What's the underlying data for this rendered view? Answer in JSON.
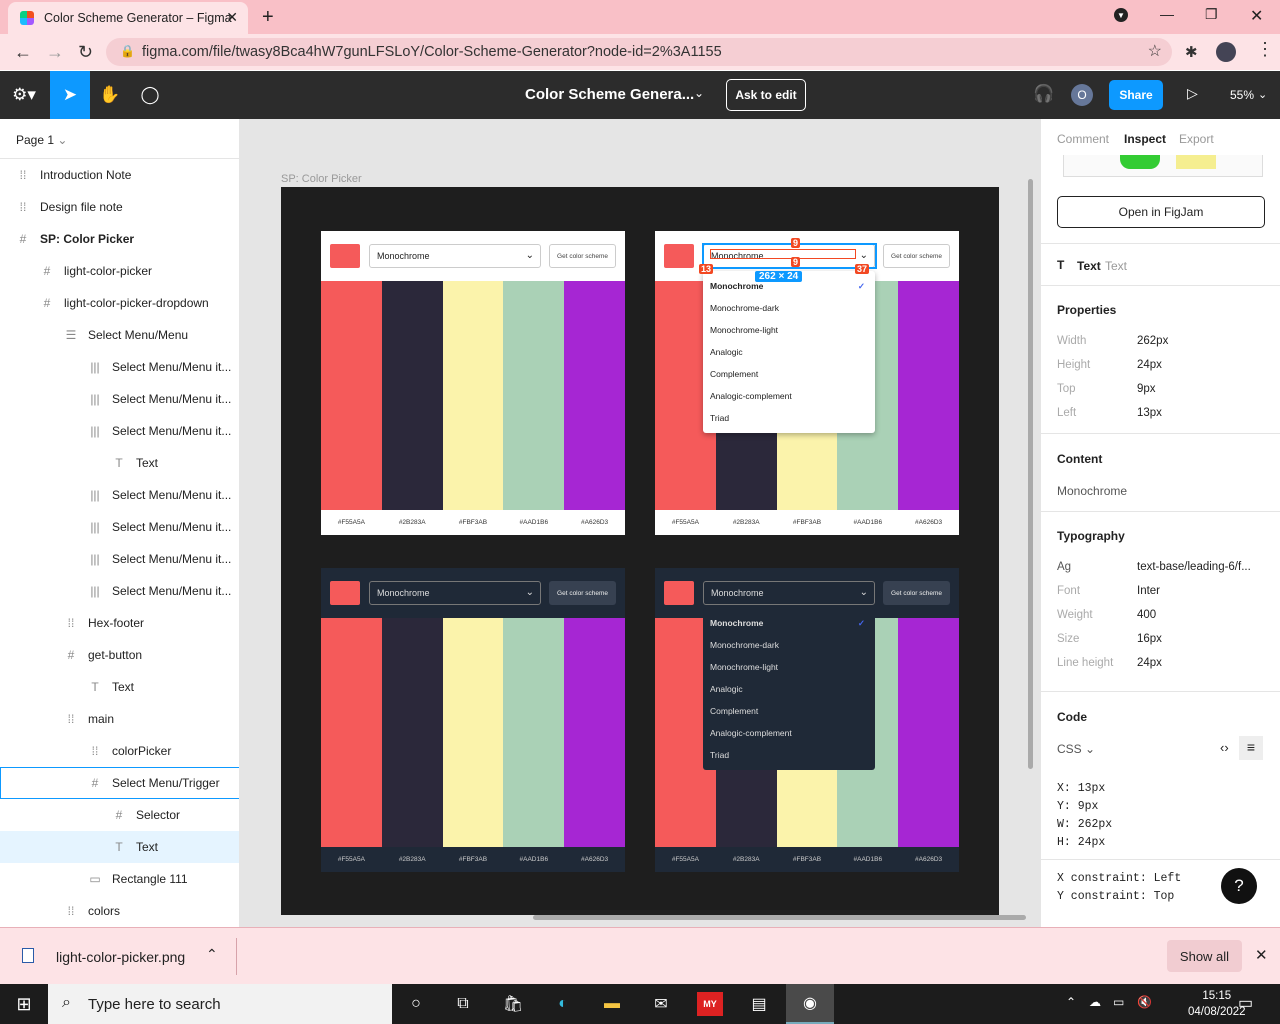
{
  "browser": {
    "tab_title": "Color Scheme Generator – Figma",
    "url": "figma.com/file/twasy8Bca4hW7gunLFSLoY/Color-Scheme-Generator?node-id=2%3A1155"
  },
  "figma": {
    "file_title": "Color Scheme Genera...",
    "ask_to_edit": "Ask to edit",
    "share": "Share",
    "avatar_letter": "O",
    "zoom": "55%"
  },
  "layers_panel": {
    "page": "Page 1",
    "items": [
      {
        "label": "Introduction Note",
        "icon": "dashed-frame-icon",
        "glyph": "⁞⁞"
      },
      {
        "label": "Design file note",
        "icon": "dashed-frame-icon",
        "glyph": "⁞⁞"
      },
      {
        "label": "SP: Color Picker",
        "icon": "frame-icon",
        "glyph": "#"
      },
      {
        "label": "light-color-picker",
        "icon": "frame-icon",
        "glyph": "#"
      },
      {
        "label": "light-color-picker-dropdown",
        "icon": "frame-icon",
        "glyph": "#"
      },
      {
        "label": "Select Menu/Menu",
        "icon": "vertical-autolayout-icon",
        "glyph": "☰"
      },
      {
        "label": "Select Menu/Menu it...",
        "icon": "horizontal-autolayout-icon",
        "glyph": "|||"
      },
      {
        "label": "Select Menu/Menu it...",
        "icon": "horizontal-autolayout-icon",
        "glyph": "|||"
      },
      {
        "label": "Select Menu/Menu it...",
        "icon": "horizontal-autolayout-icon",
        "glyph": "|||"
      },
      {
        "label": "Text",
        "icon": "text-icon",
        "glyph": "T"
      },
      {
        "label": "Select Menu/Menu it...",
        "icon": "horizontal-autolayout-icon",
        "glyph": "|||"
      },
      {
        "label": "Select Menu/Menu it...",
        "icon": "horizontal-autolayout-icon",
        "glyph": "|||"
      },
      {
        "label": "Select Menu/Menu it...",
        "icon": "horizontal-autolayout-icon",
        "glyph": "|||"
      },
      {
        "label": "Select Menu/Menu it...",
        "icon": "horizontal-autolayout-icon",
        "glyph": "|||"
      },
      {
        "label": "Hex-footer",
        "icon": "dashed-frame-icon",
        "glyph": "⁞⁞"
      },
      {
        "label": "get-button",
        "icon": "frame-icon",
        "glyph": "#"
      },
      {
        "label": "Text",
        "icon": "text-icon",
        "glyph": "T"
      },
      {
        "label": "main",
        "icon": "dashed-frame-icon",
        "glyph": "⁞⁞"
      },
      {
        "label": "colorPicker",
        "icon": "dashed-frame-icon",
        "glyph": "⁞⁞"
      },
      {
        "label": "Select Menu/Trigger",
        "icon": "frame-icon",
        "glyph": "#"
      },
      {
        "label": "Selector",
        "icon": "frame-icon",
        "glyph": "#"
      },
      {
        "label": "Text",
        "icon": "text-icon",
        "glyph": "T"
      },
      {
        "label": "Rectangle 111",
        "icon": "rectangle-icon",
        "glyph": "▭"
      },
      {
        "label": "colors",
        "icon": "dashed-frame-icon",
        "glyph": "⁞⁞"
      }
    ]
  },
  "canvas": {
    "frame_label": "SP: Color Picker",
    "select_value": "Monochrome",
    "get_button": "Get color scheme",
    "stripe_colors": [
      "#F55A5A",
      "#2B283A",
      "#FBF3AB",
      "#AAD1B6",
      "#A626D3"
    ],
    "hex_labels": [
      "#F55A5A",
      "#2B283A",
      "#FBF3AB",
      "#AAD1B6",
      "#A626D3"
    ],
    "menu_options": [
      "Monochrome",
      "Monochrome-dark",
      "Monochrome-light",
      "Analogic",
      "Complement",
      "Analogic-complement",
      "Triad"
    ],
    "measure": {
      "top": "9",
      "bottom": "9",
      "left": "13",
      "right": "37",
      "size": "262 × 24"
    }
  },
  "inspect_panel": {
    "tabs": [
      "Comment",
      "Inspect",
      "Export"
    ],
    "open_figjam": "Open in FigJam",
    "layer_type": "Text",
    "layer_name": "Text",
    "properties_title": "Properties",
    "properties": [
      {
        "label": "Width",
        "value": "262px"
      },
      {
        "label": "Height",
        "value": "24px"
      },
      {
        "label": "Top",
        "value": "9px"
      },
      {
        "label": "Left",
        "value": "13px"
      }
    ],
    "content_title": "Content",
    "content_value": "Monochrome",
    "typography_title": "Typography",
    "typography": [
      {
        "label": "Ag",
        "value": "text-base/leading-6/f..."
      },
      {
        "label": "Font",
        "value": "Inter"
      },
      {
        "label": "Weight",
        "value": "400"
      },
      {
        "label": "Size",
        "value": "16px"
      },
      {
        "label": "Line height",
        "value": "24px"
      }
    ],
    "code_title": "Code",
    "code_lang": "CSS",
    "code_lines": [
      "X: 13px",
      "Y: 9px",
      "W: 262px",
      "H: 24px"
    ],
    "constraints": [
      "X constraint: Left",
      "Y constraint: Top"
    ]
  },
  "downloads": {
    "file": "light-color-picker.png",
    "show_all": "Show all"
  },
  "taskbar": {
    "search_placeholder": "Type here to search",
    "time": "15:15",
    "date": "04/08/2022"
  }
}
